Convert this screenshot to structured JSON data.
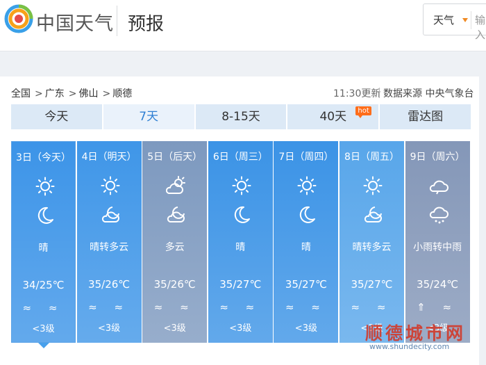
{
  "header": {
    "brand": "中国天气",
    "section": "预报",
    "search_select": "天气",
    "search_placeholder": "输入"
  },
  "breadcrumb": [
    "全国",
    "广东",
    "佛山",
    "顺德"
  ],
  "breadcrumb_sep": ">",
  "update_time": "11:30更新",
  "source": "数据来源 中央气象台",
  "tabs": [
    {
      "label": "今天"
    },
    {
      "label": "7天"
    },
    {
      "label": "8-15天"
    },
    {
      "label": "40天",
      "badge": "hot"
    },
    {
      "label": "雷达图"
    }
  ],
  "days": [
    {
      "date": "3日（今天）",
      "desc": "晴",
      "temp": "34/25℃",
      "wind": "≈ ≈",
      "wind_level": "<3级",
      "icon_day": "sun-icon",
      "icon_night": "moon-icon",
      "color": "#3c94e8"
    },
    {
      "date": "4日（明天）",
      "desc": "晴转多云",
      "temp": "35/26℃",
      "wind": "≈ ≈",
      "wind_level": "<3级",
      "icon_day": "sun-icon",
      "icon_night": "cloudy-night-icon",
      "color": "#3f96e8"
    },
    {
      "date": "5日（后天）",
      "desc": "多云",
      "temp": "35/26℃",
      "wind": "≈ ≈",
      "wind_level": "<3级",
      "icon_day": "partly-cloudy-icon",
      "icon_night": "cloudy-night-icon",
      "color": "#7d99bf"
    },
    {
      "date": "6日（周三）",
      "desc": "晴",
      "temp": "35/27℃",
      "wind": "≈ ≈",
      "wind_level": "<3级",
      "icon_day": "sun-icon",
      "icon_night": "moon-icon",
      "color": "#3b93e6"
    },
    {
      "date": "7日（周四）",
      "desc": "晴",
      "temp": "35/27℃",
      "wind": "≈ ≈",
      "wind_level": "<3级",
      "icon_day": "sun-icon",
      "icon_night": "moon-icon",
      "color": "#3b93e6"
    },
    {
      "date": "8日（周五）",
      "desc": "晴转多云",
      "temp": "35/27℃",
      "wind": "≈ ≈",
      "wind_level": "<3级",
      "icon_day": "sun-icon",
      "icon_night": "cloudy-night-icon",
      "color": "#58a6ea"
    },
    {
      "date": "9日（周六）",
      "desc": "小雨转中雨",
      "temp": "35/24℃",
      "wind": "⇑ ≈",
      "wind_level": "<3级",
      "icon_day": "cloud-icon",
      "icon_night": "rain-icon",
      "color": "#8497b8"
    }
  ],
  "watermark": {
    "text": "顺德城市网",
    "url": "www.shundecity.com"
  }
}
